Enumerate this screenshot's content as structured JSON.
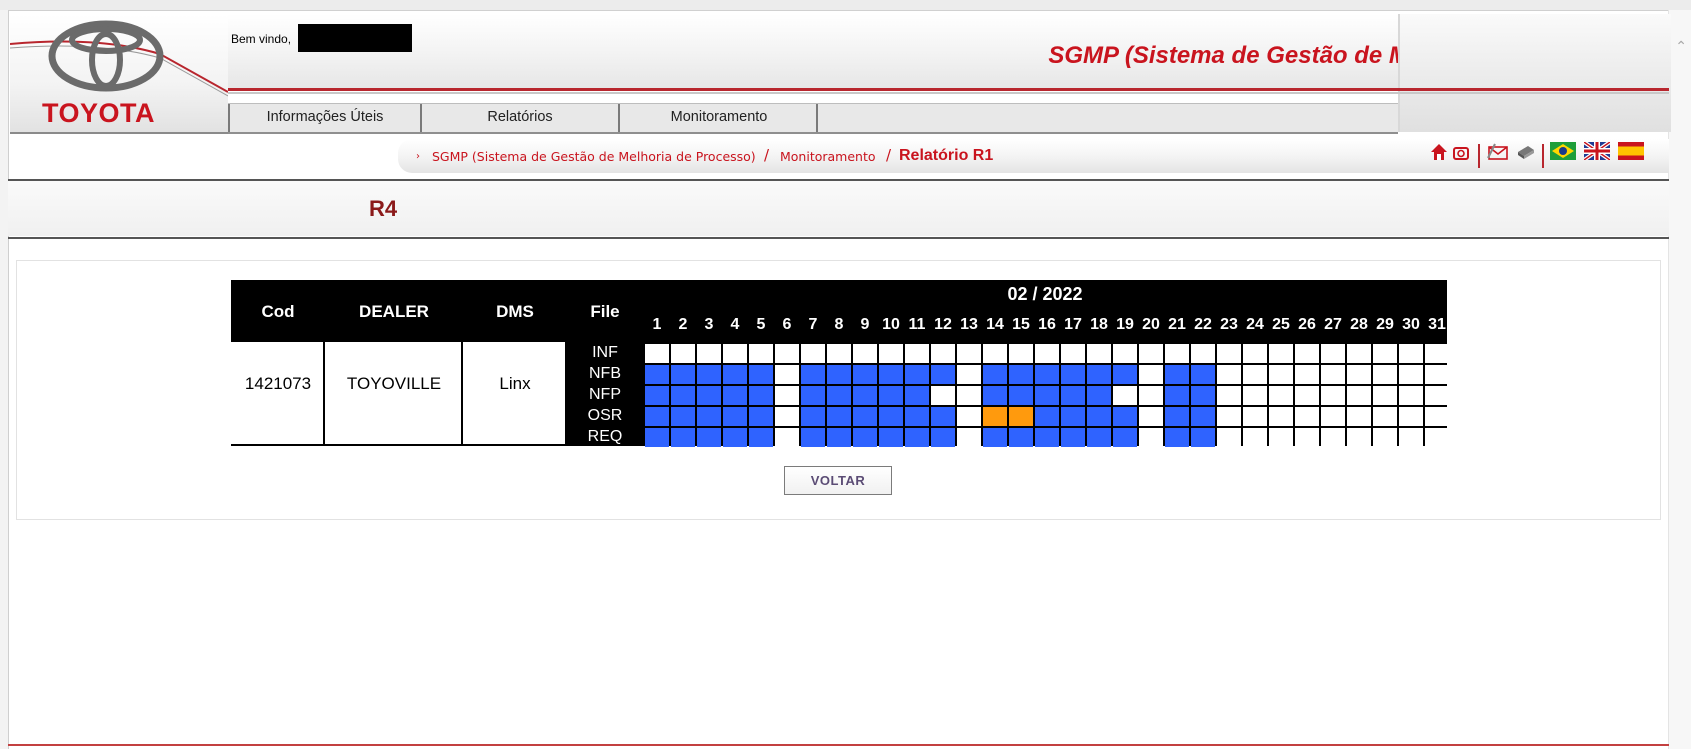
{
  "header": {
    "logo_text": "TOYOTA",
    "welcome": "Bem vindo,",
    "app_title": "SGMP (Sistema de Gestão de Melhoria de Processo)"
  },
  "menu": [
    {
      "label": "Informações Úteis"
    },
    {
      "label": "Relatórios"
    },
    {
      "label": "Monitoramento"
    }
  ],
  "breadcrumb": {
    "items": [
      "SGMP (Sistema de Gestão de Melhoria de Processo)",
      "Monitoramento"
    ],
    "current": "Relatório R1",
    "separator": "/"
  },
  "toolbar_icons": [
    "home-icon",
    "camera-icon",
    "mail-icon",
    "printer-icon",
    "flag-brazil-icon",
    "flag-uk-icon",
    "flag-spain-icon"
  ],
  "section_title": "R4",
  "table": {
    "headers": {
      "cod": "Cod",
      "dealer": "DEALER",
      "dms": "DMS",
      "file": "File"
    },
    "month": "02 / 2022",
    "days": [
      "1",
      "2",
      "3",
      "4",
      "5",
      "6",
      "7",
      "8",
      "9",
      "10",
      "11",
      "12",
      "13",
      "14",
      "15",
      "16",
      "17",
      "18",
      "19",
      "20",
      "21",
      "22",
      "23",
      "24",
      "25",
      "26",
      "27",
      "28",
      "29",
      "30",
      "31"
    ],
    "row": {
      "cod": "1421073",
      "dealer": "TOYOVILLE",
      "dms": "Linx"
    },
    "files": [
      {
        "name": "INF",
        "status": "wwwwwwwwwwwwwwwwwwwwwwwwwwwwwww"
      },
      {
        "name": "NFB",
        "status": "bbbbbwbbbbbbwbbbbbbwbbwwwwwwwww"
      },
      {
        "name": "NFP",
        "status": "bbbbbwbbbbbwwbbbbbwwbbwwwwwwwww"
      },
      {
        "name": "OSR",
        "status": "bbbbbwbbbbbbwoobbbbwbbwwwwwwwww"
      },
      {
        "name": "REQ",
        "status": "bbbbbwbbbbbbwbbbbbbwbbwwwwwwwww"
      }
    ],
    "status_colors": {
      "b": "#2f63ff",
      "o": "#ff9a0d",
      "w": "#ffffff"
    }
  },
  "button": {
    "voltar": "VOLTAR"
  }
}
